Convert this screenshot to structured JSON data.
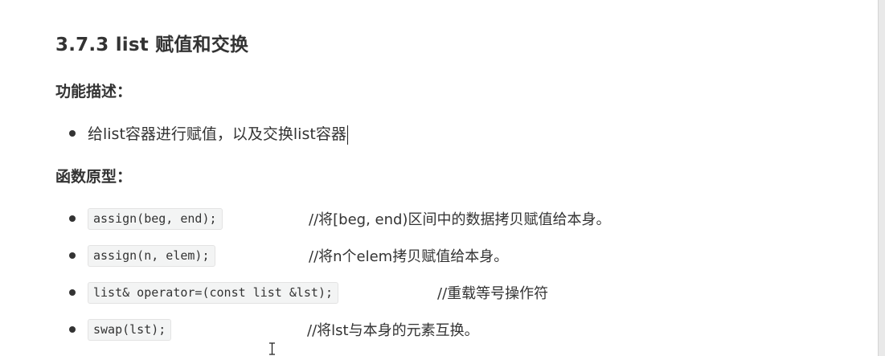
{
  "doc": {
    "title": "3.7.3 list 赋值和交换",
    "sections": {
      "function_desc": {
        "heading": "功能描述：",
        "items": [
          "给list容器进行赋值，以及交换list容器"
        ]
      },
      "prototypes": {
        "heading": "函数原型：",
        "items": [
          {
            "code": "assign(beg, end);",
            "comment": "//将[beg, end)区间中的数据拷贝赋值给本身。"
          },
          {
            "code": "assign(n, elem);",
            "comment": "//将n个elem拷贝赋值给本身。"
          },
          {
            "code": "list& operator=(const list &lst);",
            "comment": "//重载等号操作符"
          },
          {
            "code": "swap(lst);",
            "comment": "//将lst与本身的元素互换。"
          }
        ]
      }
    }
  }
}
